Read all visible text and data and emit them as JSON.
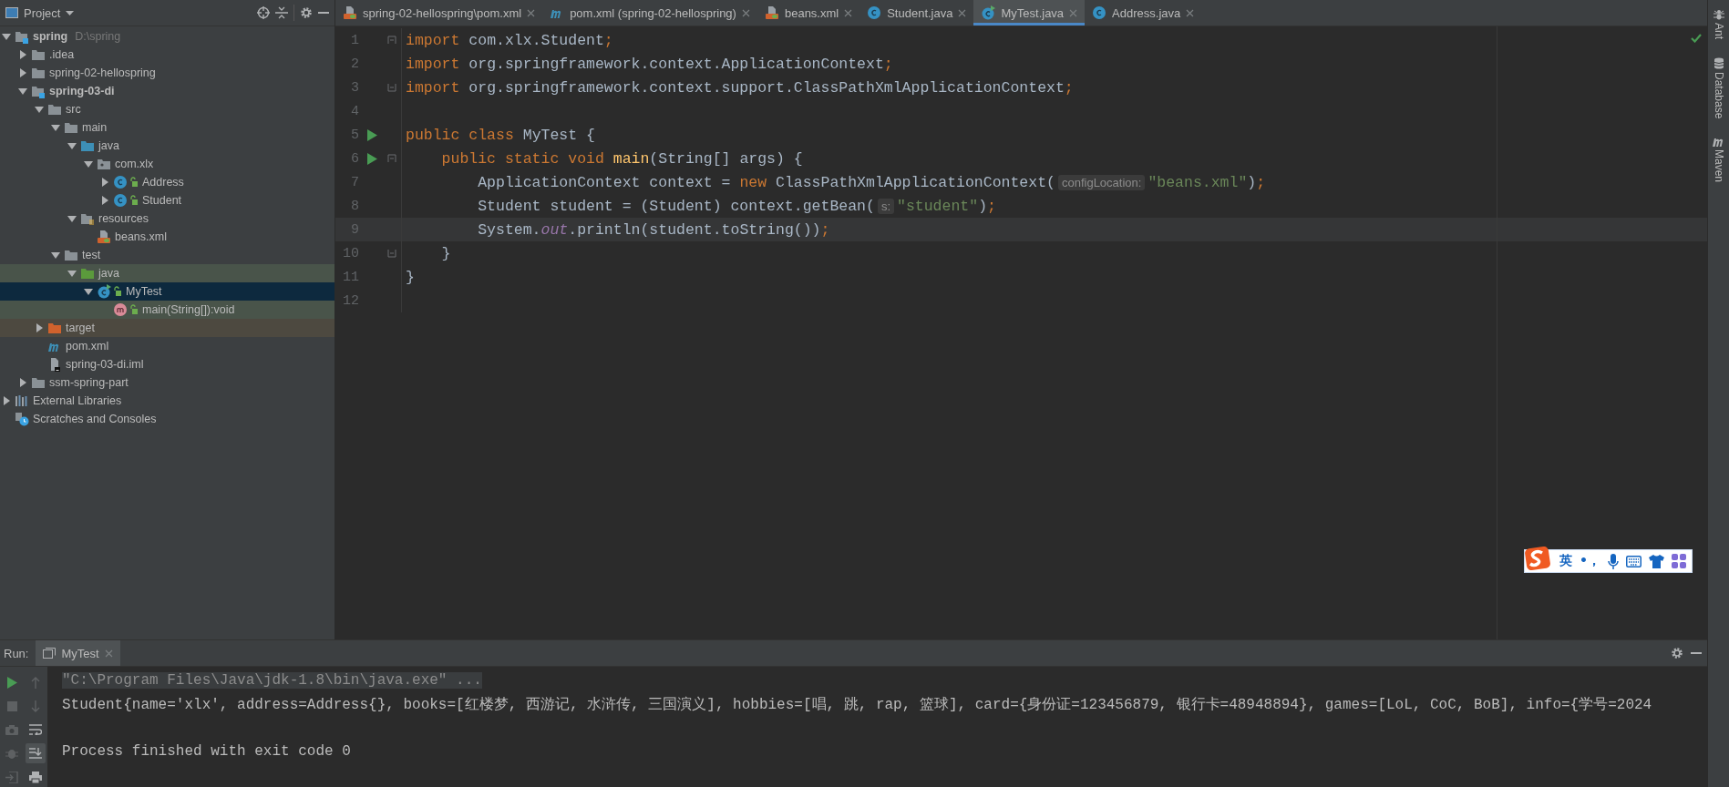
{
  "project_panel": {
    "title": "Project"
  },
  "tree": [
    {
      "label": "spring",
      "hint": "D:\\spring",
      "bold": true,
      "kind": "module",
      "expanded": true,
      "selected": false,
      "children": [
        {
          "label": ".idea",
          "kind": "folder",
          "expanded": false,
          "selected": false
        },
        {
          "label": "spring-02-hellospring",
          "kind": "folder",
          "expanded": false,
          "selected": false
        },
        {
          "label": "spring-03-di",
          "bold": true,
          "kind": "module",
          "expanded": true,
          "selected": false,
          "children": [
            {
              "label": "src",
              "kind": "folder",
              "expanded": true,
              "selected": false,
              "children": [
                {
                  "label": "main",
                  "kind": "folder",
                  "expanded": true,
                  "selected": false,
                  "children": [
                    {
                      "label": "java",
                      "kind": "source-folder",
                      "expanded": true,
                      "selected": false,
                      "children": [
                        {
                          "label": "com.xlx",
                          "kind": "package",
                          "expanded": true,
                          "selected": false,
                          "children": [
                            {
                              "label": "Address",
                              "kind": "class",
                              "expanded": false,
                              "selected": false
                            },
                            {
                              "label": "Student",
                              "kind": "class",
                              "expanded": false,
                              "selected": false
                            }
                          ]
                        }
                      ]
                    },
                    {
                      "label": "resources",
                      "kind": "resources",
                      "expanded": true,
                      "selected": false,
                      "children": [
                        {
                          "label": "beans.xml",
                          "kind": "xml",
                          "selected": false
                        }
                      ]
                    }
                  ]
                },
                {
                  "label": "test",
                  "kind": "folder",
                  "expanded": true,
                  "selected": false,
                  "children": [
                    {
                      "label": "java",
                      "kind": "test-folder",
                      "expanded": true,
                      "selected": false,
                      "test_scope": true,
                      "children": [
                        {
                          "label": "MyTest",
                          "kind": "test-class",
                          "expanded": true,
                          "selected": true,
                          "children": [
                            {
                              "label": "main(String[]):void",
                              "kind": "method",
                              "selected": false,
                              "test_scope": true
                            }
                          ]
                        }
                      ]
                    }
                  ]
                }
              ]
            },
            {
              "label": "target",
              "kind": "excluded-folder",
              "expanded": false,
              "selected": false,
              "excluded": true
            },
            {
              "label": "pom.xml",
              "kind": "maven",
              "selected": false
            },
            {
              "label": "spring-03-di.iml",
              "kind": "iml",
              "selected": false
            }
          ]
        },
        {
          "label": "ssm-spring-part",
          "kind": "folder",
          "expanded": false,
          "selected": false
        }
      ]
    },
    {
      "label": "External Libraries",
      "kind": "libraries",
      "expanded": false,
      "selected": false
    },
    {
      "label": "Scratches and Consoles",
      "kind": "scratches",
      "selected": false
    }
  ],
  "tabs": [
    {
      "label": "spring-02-hellospring\\pom.xml",
      "kind": "xml",
      "selected": false
    },
    {
      "label": "pom.xml (spring-02-hellospring)",
      "kind": "maven",
      "selected": false
    },
    {
      "label": "beans.xml",
      "kind": "xml",
      "selected": false
    },
    {
      "label": "Student.java",
      "kind": "class",
      "selected": false
    },
    {
      "label": "MyTest.java",
      "kind": "test-class",
      "selected": true
    },
    {
      "label": "Address.java",
      "kind": "class",
      "selected": false
    }
  ],
  "code_lines": [
    {
      "number": "1",
      "fold_start": true,
      "tokens": [
        {
          "kind": "kw",
          "t": "import"
        },
        {
          "kind": "plain",
          "t": " com.xlx.Student"
        },
        {
          "kind": "semi",
          "t": ";"
        }
      ]
    },
    {
      "number": "2",
      "tokens": [
        {
          "kind": "kw",
          "t": "import"
        },
        {
          "kind": "plain",
          "t": " org.springframework.context.ApplicationContext"
        },
        {
          "kind": "semi",
          "t": ";"
        }
      ]
    },
    {
      "number": "3",
      "fold_end": true,
      "tokens": [
        {
          "kind": "kw",
          "t": "import"
        },
        {
          "kind": "plain",
          "t": " org.springframework.context.support.ClassPathXmlApplicationContext"
        },
        {
          "kind": "semi",
          "t": ";"
        }
      ]
    },
    {
      "number": "4"
    },
    {
      "number": "5",
      "run": true,
      "tokens": [
        {
          "kind": "kw",
          "t": "public class"
        },
        {
          "kind": "plain",
          "t": " MyTest {"
        }
      ]
    },
    {
      "number": "6",
      "run": true,
      "fold_start": true,
      "tokens": [
        {
          "kind": "kw",
          "t": "    public static void "
        },
        {
          "kind": "fn",
          "t": "main"
        },
        {
          "kind": "plain",
          "t": "(String[] args) {"
        }
      ]
    },
    {
      "number": "7",
      "tokens": [
        {
          "kind": "plain",
          "t": "        ApplicationContext context = "
        },
        {
          "kind": "kw",
          "t": "new"
        },
        {
          "kind": "plain",
          "t": " ClassPathXmlApplicationContext("
        },
        {
          "kind": "hint",
          "t": "configLocation:"
        },
        {
          "kind": "str",
          "t": "\"beans.xml\""
        },
        {
          "kind": "plain",
          "t": ")"
        },
        {
          "kind": "semi",
          "t": ";"
        }
      ]
    },
    {
      "number": "8",
      "tokens": [
        {
          "kind": "plain",
          "t": "        Student student = (Student) context.getBean("
        },
        {
          "kind": "hint",
          "t": "s:"
        },
        {
          "kind": "str",
          "t": "\"student\""
        },
        {
          "kind": "plain",
          "t": ")"
        },
        {
          "kind": "semi",
          "t": ";"
        }
      ]
    },
    {
      "number": "9",
      "current": true,
      "tokens": [
        {
          "kind": "plain",
          "t": "        System."
        },
        {
          "kind": "field",
          "t": "out"
        },
        {
          "kind": "plain",
          "t": ".println(student.toString())"
        },
        {
          "kind": "semi",
          "t": ";"
        }
      ]
    },
    {
      "number": "10",
      "fold_end": true,
      "tokens": [
        {
          "kind": "plain",
          "t": "    }"
        }
      ]
    },
    {
      "number": "11",
      "tokens": [
        {
          "kind": "plain",
          "t": "}"
        }
      ]
    },
    {
      "number": "12"
    }
  ],
  "side_tools": [
    {
      "label": "Ant",
      "kind": "ant"
    },
    {
      "label": "Database",
      "kind": "database"
    },
    {
      "label": "Maven",
      "kind": "maven"
    }
  ],
  "run_panel": {
    "title": "Run:",
    "tabs": [
      {
        "label": "MyTest",
        "selected": true
      }
    ],
    "console": [
      {
        "kind": "command",
        "text": "\"C:\\Program Files\\Java\\jdk-1.8\\bin\\java.exe\" ..."
      },
      {
        "kind": "output",
        "text": "Student{name='xlx', address=Address{}, books=[红楼梦, 西游记, 水浒传, 三国演义], hobbies=[唱, 跳, rap, 篮球], card={身份证=123456879, 银行卡=48948894}, games=[LoL, CoC, BoB], info={学号=2024"
      },
      {
        "kind": "status",
        "text": "Process finished with exit code 0"
      }
    ]
  },
  "ime": {
    "language": "英",
    "punctuation": "•，"
  }
}
